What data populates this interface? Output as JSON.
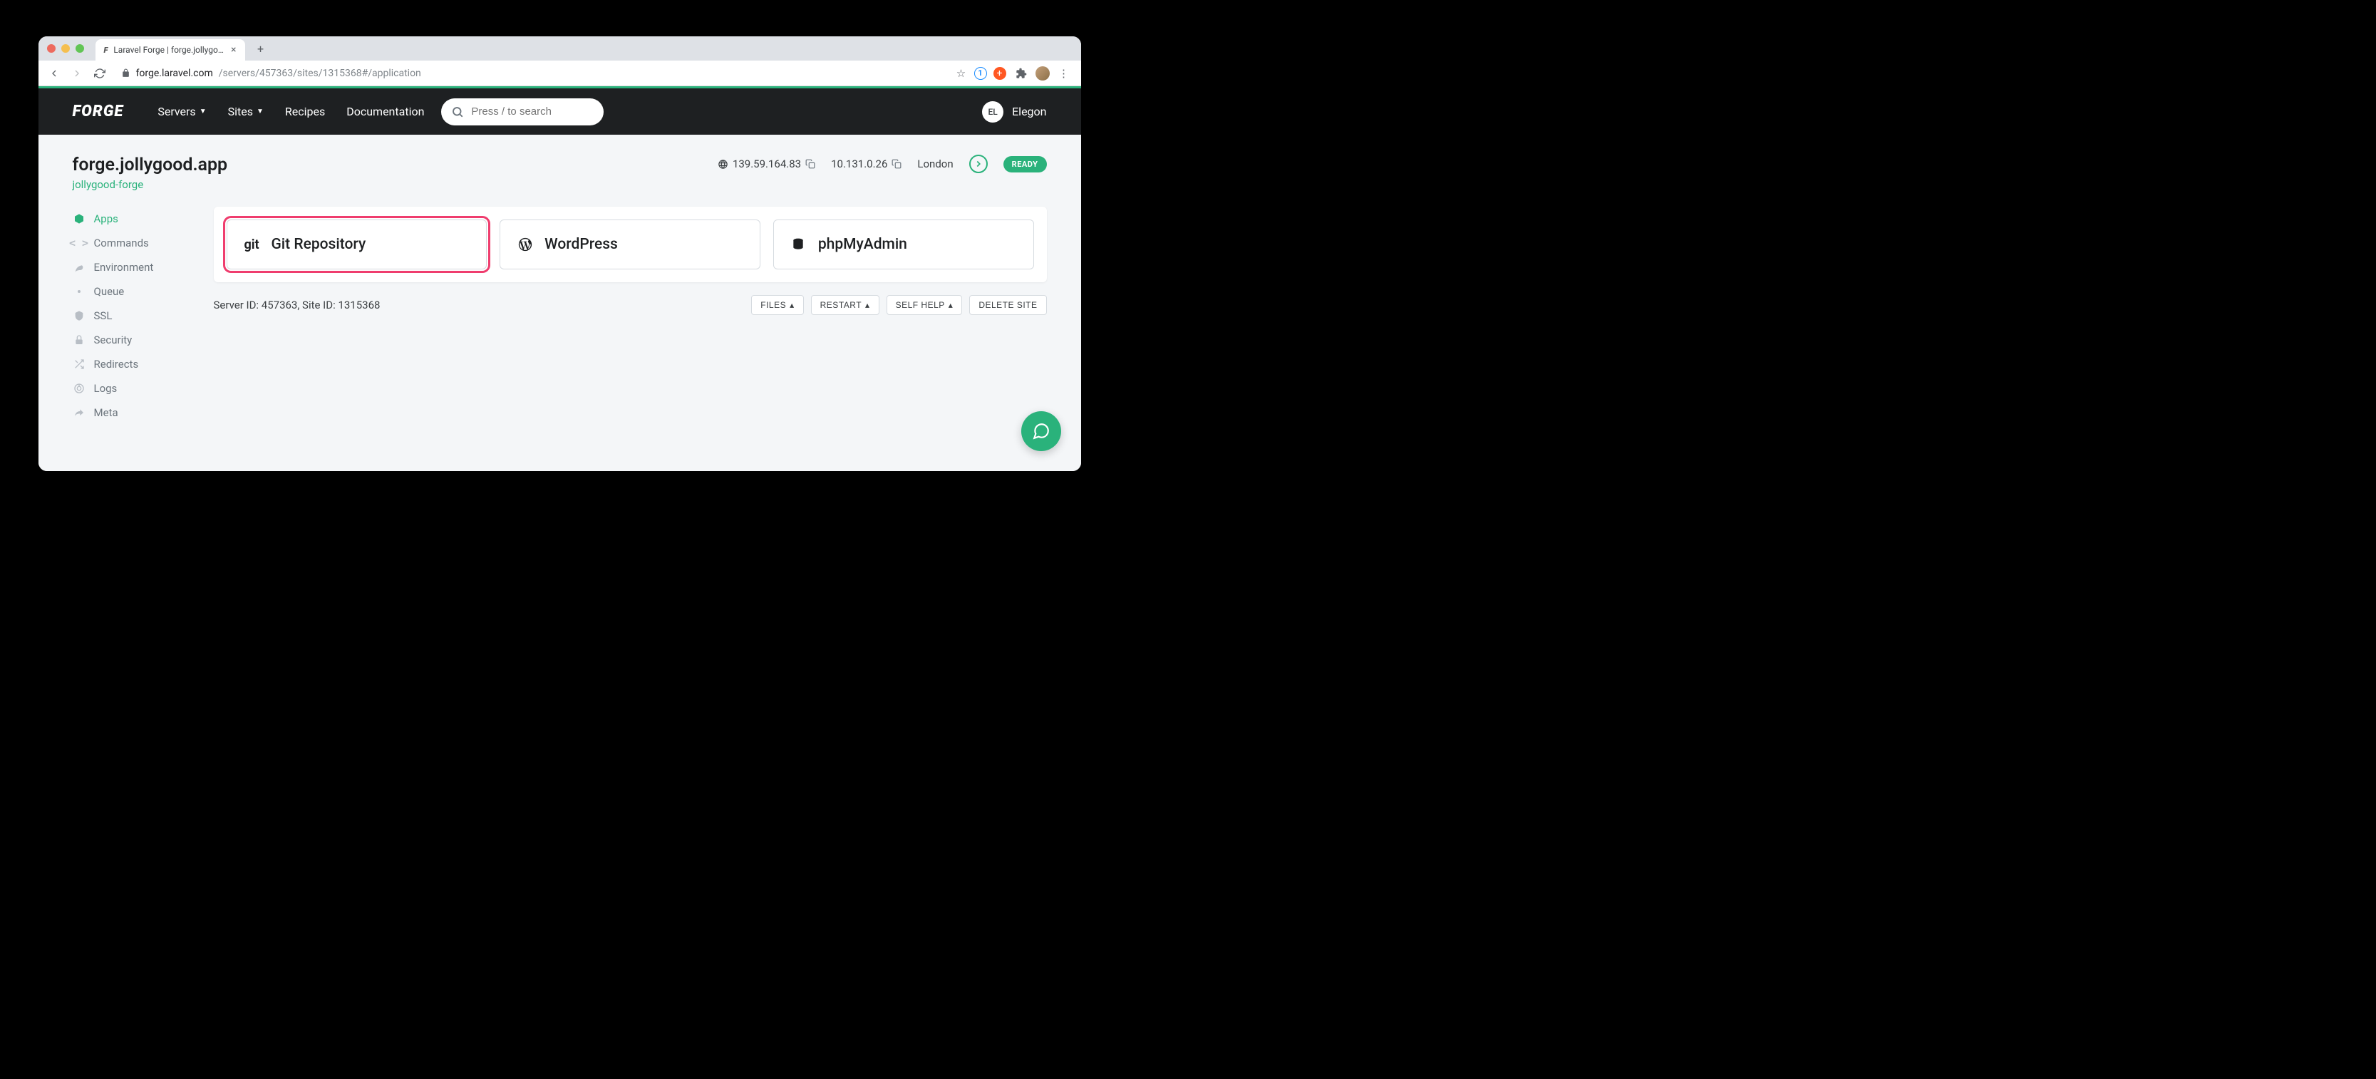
{
  "browser": {
    "tab_title": "Laravel Forge | forge.jollygood",
    "url_host": "forge.laravel.com",
    "url_path": "/servers/457363/sites/1315368#/application"
  },
  "header": {
    "logo": "FORGE",
    "nav": {
      "servers": "Servers",
      "sites": "Sites",
      "recipes": "Recipes",
      "documentation": "Documentation"
    },
    "search_placeholder": "Press / to search",
    "user_initials": "EL",
    "user_name": "Elegon"
  },
  "site": {
    "title": "forge.jollygood.app",
    "server_link": "jollygood-forge",
    "public_ip": "139.59.164.83",
    "private_ip": "10.131.0.26",
    "region": "London",
    "status": "READY"
  },
  "sidebar": {
    "items": [
      {
        "label": "Apps"
      },
      {
        "label": "Commands"
      },
      {
        "label": "Environment"
      },
      {
        "label": "Queue"
      },
      {
        "label": "SSL"
      },
      {
        "label": "Security"
      },
      {
        "label": "Redirects"
      },
      {
        "label": "Logs"
      },
      {
        "label": "Meta"
      }
    ]
  },
  "cards": {
    "git": "Git Repository",
    "wordpress": "WordPress",
    "phpmyadmin": "phpMyAdmin"
  },
  "footer": {
    "ids": "Server ID: 457363, Site ID: 1315368",
    "files": "FILES",
    "restart": "RESTART",
    "self_help": "SELF HELP",
    "delete": "DELETE SITE"
  }
}
